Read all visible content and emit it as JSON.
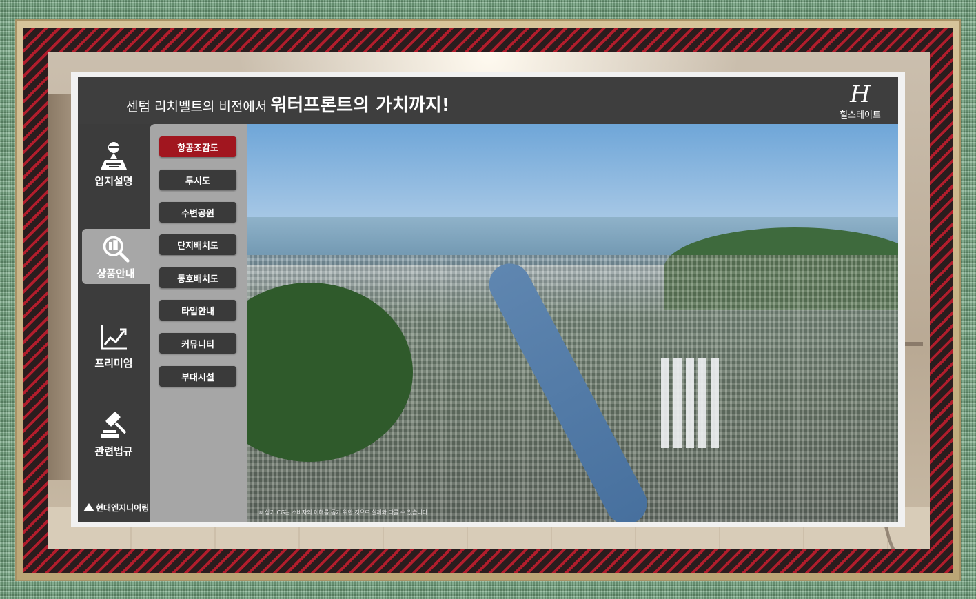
{
  "header": {
    "title_small": "센텀 리치벨트의 비전에서",
    "title_big": "워터프론트의 가치까지!"
  },
  "brand": {
    "mark": "H",
    "name": "힐스테이트"
  },
  "nav": {
    "items": [
      {
        "label": "입지설명",
        "icon": "location-icon",
        "active": false
      },
      {
        "label": "상품안내",
        "icon": "magnify-building-icon",
        "active": true
      },
      {
        "label": "프리미엄",
        "icon": "chart-growth-icon",
        "active": false
      },
      {
        "label": "관련법규",
        "icon": "gavel-icon",
        "active": false
      }
    ],
    "corp_name": "현대엔지니어링"
  },
  "submenu": {
    "items": [
      {
        "label": "항공조감도",
        "active": true
      },
      {
        "label": "투시도",
        "active": false
      },
      {
        "label": "수변공원",
        "active": false
      },
      {
        "label": "단지배치도",
        "active": false
      },
      {
        "label": "동호배치도",
        "active": false
      },
      {
        "label": "타입안내",
        "active": false
      },
      {
        "label": "커뮤니티",
        "active": false
      },
      {
        "label": "부대시설",
        "active": false
      }
    ]
  },
  "aerial": {
    "disclaimer": "※ 상기 CG는 소비자의 이해를 돕기 위한 것으로 실제와 다를 수 있습니다."
  },
  "colors": {
    "active_submenu": "#a1161f",
    "header_bg": "#3e3e3e",
    "submenu_bg": "#a6a6a6"
  }
}
